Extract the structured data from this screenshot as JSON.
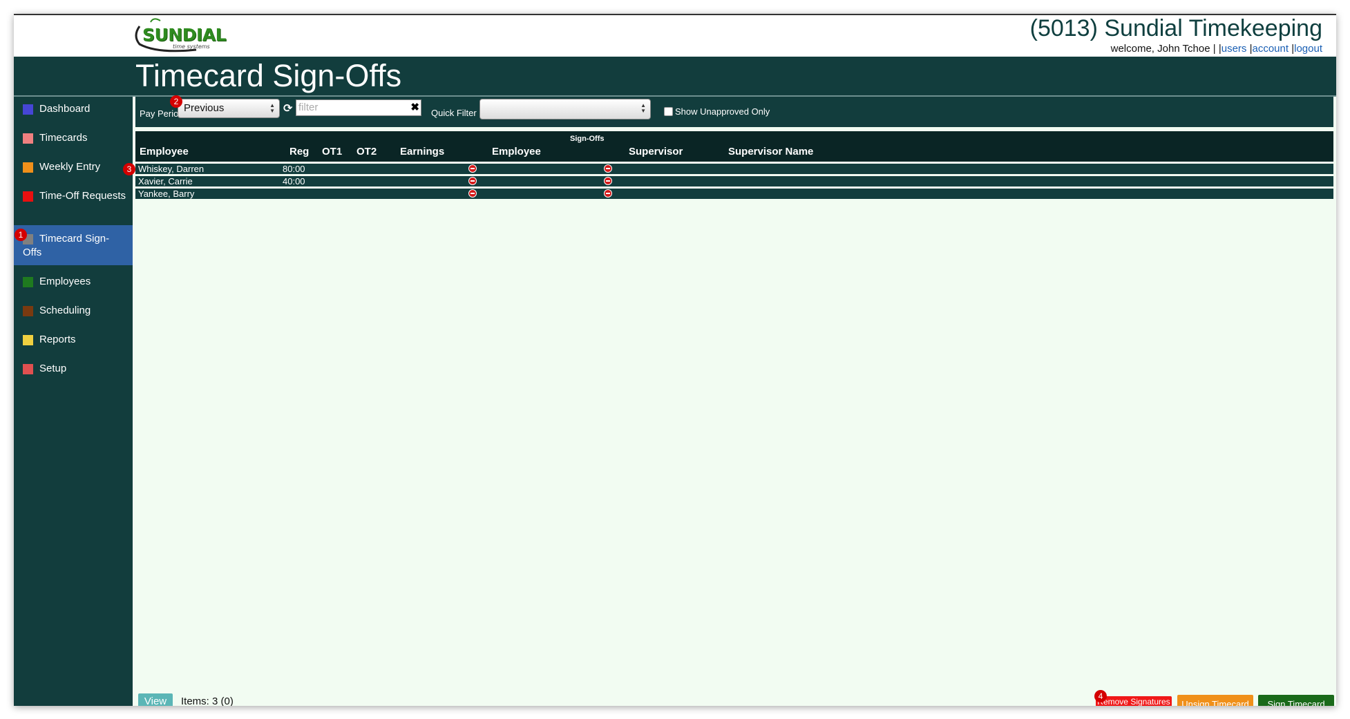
{
  "app": {
    "logo_text": "SUNDIAL",
    "logo_subtext": "time systems",
    "title": "(5013) Sundial Timekeeping",
    "welcome": "welcome, John Tchoe |",
    "links": {
      "users": "users",
      "account": "account",
      "logout": "logout"
    },
    "page_title": "Timecard Sign-Offs"
  },
  "sidebar": {
    "items": [
      {
        "label": "Dashboard",
        "color": "#4646d6"
      },
      {
        "label": "Timecards",
        "color": "#f08080"
      },
      {
        "label": "Weekly Entry",
        "color": "#f0901a"
      },
      {
        "label": "Time-Off Requests",
        "color": "#e81010"
      },
      {
        "label": "Timecard Sign-Offs",
        "color": "#808080"
      },
      {
        "label": "Employees",
        "color": "#1f7a1f"
      },
      {
        "label": "Scheduling",
        "color": "#7a3a10"
      },
      {
        "label": "Reports",
        "color": "#f0d040"
      },
      {
        "label": "Setup",
        "color": "#e05050"
      }
    ]
  },
  "badges": [
    "1",
    "2",
    "3",
    "4"
  ],
  "toolbar": {
    "pay_period_label": "Pay Period",
    "pay_period_value": "Previous",
    "filter_placeholder": "filter",
    "quick_filter_label": "Quick Filter",
    "quick_filter_value": "",
    "show_unapproved_label": "Show Unapproved Only"
  },
  "table": {
    "group_header": "Sign-Offs",
    "columns": [
      "Employee",
      "Reg",
      "OT1",
      "OT2",
      "Earnings",
      "Employee",
      "Supervisor",
      "Supervisor Name"
    ],
    "rows": [
      {
        "name": "Whiskey, Darren",
        "reg": "80:00"
      },
      {
        "name": "Xavier, Carrie",
        "reg": "40:00"
      },
      {
        "name": "Yankee, Barry",
        "reg": ""
      }
    ]
  },
  "footer": {
    "view_label": "View",
    "items_text": "Items: 3 (0)",
    "remove_signatures": "Remove Signatures",
    "unsign_timecard": "Unsign Timecard",
    "sign_timecard": "Sign Timecard"
  },
  "colors": {
    "brand_dark": "#123d3d",
    "active_nav": "#2f62a5",
    "remove": "#f01818",
    "unsign": "#f0901a",
    "sign": "#1a6a1a"
  }
}
